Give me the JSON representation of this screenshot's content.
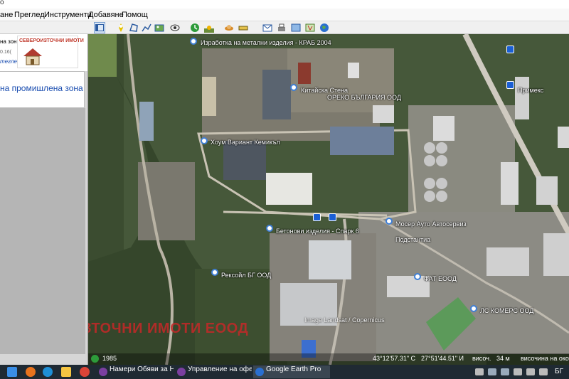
{
  "window": {
    "app_glyph": "o"
  },
  "menu": {
    "items": [
      "ане",
      "Преглед",
      "Инструменти",
      "Добавяне",
      "Помощ"
    ]
  },
  "toolbar": {
    "icons": [
      "sidebar-toggle-icon",
      "placemark-icon",
      "polygon-icon",
      "path-icon",
      "image-overlay-icon",
      "record-tour-icon",
      "historical-imagery-icon",
      "sunlight-icon",
      "planets-icon",
      "ruler-icon",
      "email-icon",
      "print-icon",
      "save-image-icon",
      "view-in-maps-icon",
      "earth-icon"
    ]
  },
  "sidebar": {
    "search_text": "на зон",
    "search_small": "0.16(",
    "places_fragment": "теглед... история",
    "brand_name": "СЕВЕРОИЗТОЧНИ ИМОТИ",
    "list_item": "на промишлена зона"
  },
  "map_labels": {
    "label_1": "Изработка на метални изделия - КРАБ 2004",
    "label_2": "Китайска Стена",
    "label_3": "ОРЕКО БЪЛГАРИЯ ООД",
    "label_4": "Хоум Вариант Кемикъл",
    "label_5": "Бетонови изделия - Спарк 6",
    "label_6": "Мосер Ауто Автосервиз",
    "label_7": "Подстантиа",
    "label_8": "Рексойл БГ ООД",
    "label_9": "ФАТ ЕООД",
    "label_10": "ЛС КОМЕРС ООД",
    "label_11": "Примекс"
  },
  "watermark": "СЕВЕРОИЗТОЧНИ ИМОТИ ЕООД",
  "attribution": "Image Landsat / Copernicus",
  "statusbar": {
    "year": "1985",
    "lat": "43°12'57.31\" С",
    "lon": "27°51'44.51\" И",
    "elev_label": "височ.",
    "elev_value": "34 м",
    "eye_alt": "височина на окото"
  },
  "taskbar": {
    "tasks": [
      "Намери Обяви за Не...",
      "Управление на офер...",
      "Google Earth Pro"
    ],
    "lang": "БГ"
  },
  "colors": {
    "accent_blue": "#1a4db0",
    "watermark_red": "#c42828",
    "bus_blue": "#1a5fd4",
    "taskbar": "#1f2a33"
  }
}
